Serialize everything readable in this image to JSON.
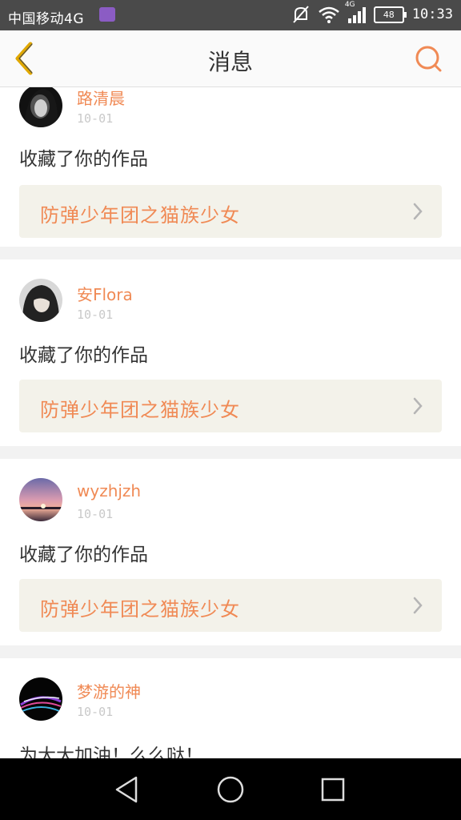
{
  "status_bar": {
    "carrier": "中国移动4G",
    "network": "4G",
    "battery": "48",
    "time": "10:33"
  },
  "header": {
    "title": "消息",
    "back_icon": "chevron-left-icon",
    "search_icon": "search-icon"
  },
  "colors": {
    "accent": "#f08a55",
    "back_icon": "#e0a800",
    "card_box_bg": "#f3f2ea"
  },
  "messages": [
    {
      "user": "路清晨",
      "date": "10-01",
      "action": "收藏了你的作品",
      "work": "防弹少年团之猫族少女"
    },
    {
      "user": "安Flora",
      "date": "10-01",
      "action": "收藏了你的作品",
      "work": "防弹少年团之猫族少女"
    },
    {
      "user": "wyzhjzh",
      "date": "10-01",
      "action": "收藏了你的作品",
      "work": "防弹少年团之猫族少女"
    },
    {
      "user": "梦游的神",
      "date": "10-01",
      "action": "为大大加油！么么哒！"
    }
  ]
}
